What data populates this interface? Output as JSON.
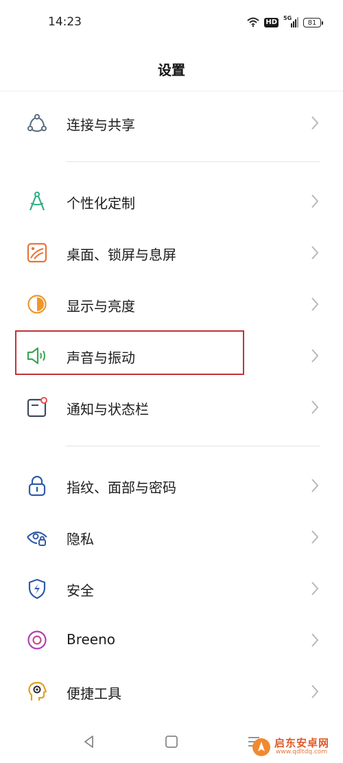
{
  "status_bar": {
    "time": "14:23",
    "hd": "HD",
    "network": "5G",
    "battery": "81",
    "icons": [
      "wifi-icon",
      "hd-icon",
      "signal-5g-icon",
      "battery-icon"
    ]
  },
  "header": {
    "title": "设置"
  },
  "settings": {
    "items": [
      {
        "label": "连接与共享",
        "icon": "share-network-icon",
        "color": "#5a6a80"
      },
      {
        "label": "个性化定制",
        "icon": "compass-icon",
        "color": "#2fae82"
      },
      {
        "label": "桌面、锁屏与息屏",
        "icon": "wallpaper-icon",
        "color": "#e8743a"
      },
      {
        "label": "显示与亮度",
        "icon": "brightness-icon",
        "color": "#f0962a"
      },
      {
        "label": "声音与振动",
        "icon": "speaker-icon",
        "color": "#3aa656"
      },
      {
        "label": "通知与状态栏",
        "icon": "notification-icon",
        "color": "#3c4a5e"
      },
      {
        "label": "指纹、面部与密码",
        "icon": "lock-icon",
        "color": "#2f5aa8"
      },
      {
        "label": "隐私",
        "icon": "privacy-eye-icon",
        "color": "#2f5aa8"
      },
      {
        "label": "安全",
        "icon": "shield-icon",
        "color": "#2f5aa8"
      },
      {
        "label": "Breeno",
        "icon": "breeno-icon",
        "color": "#b03fb5"
      },
      {
        "label": "便捷工具",
        "icon": "tools-head-icon",
        "color": "#e0a020"
      }
    ]
  },
  "nav": {
    "buttons": [
      "back-icon",
      "home-icon",
      "recents-icon"
    ]
  },
  "watermark": {
    "title": "启东安卓网",
    "url": "www.qdltdq.com"
  },
  "colors": {
    "highlight": "#c0323a",
    "chevron": "#b8b8b8",
    "divider": "#e3e3e3"
  }
}
